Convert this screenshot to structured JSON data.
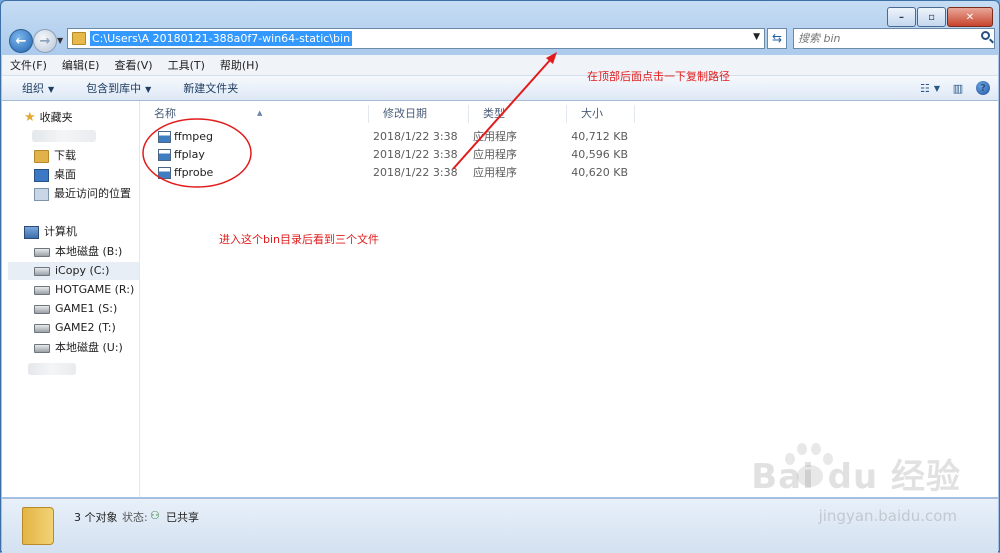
{
  "window": {
    "controls": {
      "minimize": "–",
      "maximize": "▫",
      "close": "✕"
    }
  },
  "address": {
    "path": "C:\\Users\\A                                      20180121-388a0f7-win64-static\\bin",
    "search_placeholder": "搜索 bin"
  },
  "menu": [
    "文件(F)",
    "编辑(E)",
    "查看(V)",
    "工具(T)",
    "帮助(H)"
  ],
  "toolbar": {
    "organize": "组织",
    "include_library": "包含到库中",
    "new_folder": "新建文件夹"
  },
  "nav": {
    "favorites": "收藏夹",
    "downloads": "下载",
    "desktop": "桌面",
    "recent": "最近访问的位置",
    "computer": "计算机",
    "drives": [
      "本地磁盘 (B:)",
      "iCopy (C:)",
      "HOTGAME (R:)",
      "GAME1 (S:)",
      "GAME2 (T:)",
      "本地磁盘 (U:)"
    ]
  },
  "columns": {
    "name": "名称",
    "date": "修改日期",
    "type": "类型",
    "size": "大小"
  },
  "files": [
    {
      "name": "ffmpeg",
      "date": "2018/1/22 3:38",
      "type": "应用程序",
      "size": "40,712 KB"
    },
    {
      "name": "ffplay",
      "date": "2018/1/22 3:38",
      "type": "应用程序",
      "size": "40,596 KB"
    },
    {
      "name": "ffprobe",
      "date": "2018/1/22 3:38",
      "type": "应用程序",
      "size": "40,620 KB"
    }
  ],
  "annotations": {
    "top": "在顶部后面点击一下复制路径",
    "middle": "进入这个bin目录后看到三个文件"
  },
  "status": {
    "count": "3 个对象",
    "state_label": "状态:",
    "shared": "已共享"
  },
  "watermark": {
    "brand": "Bai du 经验",
    "url": "jingyan.baidu.com"
  },
  "colors": {
    "annotation": "#e11b1b",
    "selection": "#3399ff"
  }
}
